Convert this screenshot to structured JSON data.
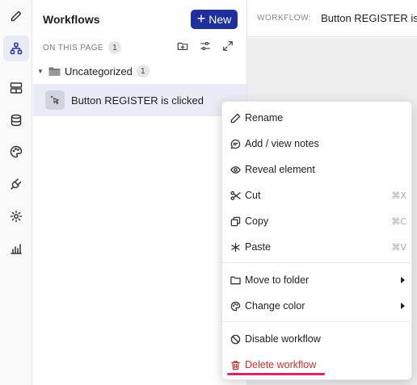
{
  "sidebar": {
    "icons": [
      "pencil-icon",
      "workflow-icon",
      "layout-icon",
      "database-icon",
      "palette-icon",
      "plug-icon",
      "gear-icon",
      "chart-icon"
    ],
    "active": "workflow-icon"
  },
  "workflows_panel": {
    "title": "Workflows",
    "new_button": "New",
    "section_label": "ON THIS PAGE",
    "section_count": "1",
    "folder": {
      "name": "Uncategorized",
      "count": "1"
    },
    "item": {
      "label": "Button REGISTER is clicked"
    }
  },
  "header": {
    "label": "WORKFLOW:",
    "value": "Button REGISTER is clicked"
  },
  "context_menu": {
    "rename": "Rename",
    "notes": "Add / view notes",
    "reveal": "Reveal element",
    "cut": "Cut",
    "cut_shortcut": "⌘X",
    "copy": "Copy",
    "copy_shortcut": "⌘C",
    "paste": "Paste",
    "paste_shortcut": "⌘V",
    "move": "Move to folder",
    "color": "Change color",
    "disable": "Disable workflow",
    "delete": "Delete workflow"
  },
  "colors": {
    "accent": "#1f2f9c",
    "danger": "#c8302f",
    "highlight_underline": "#e0226b"
  }
}
